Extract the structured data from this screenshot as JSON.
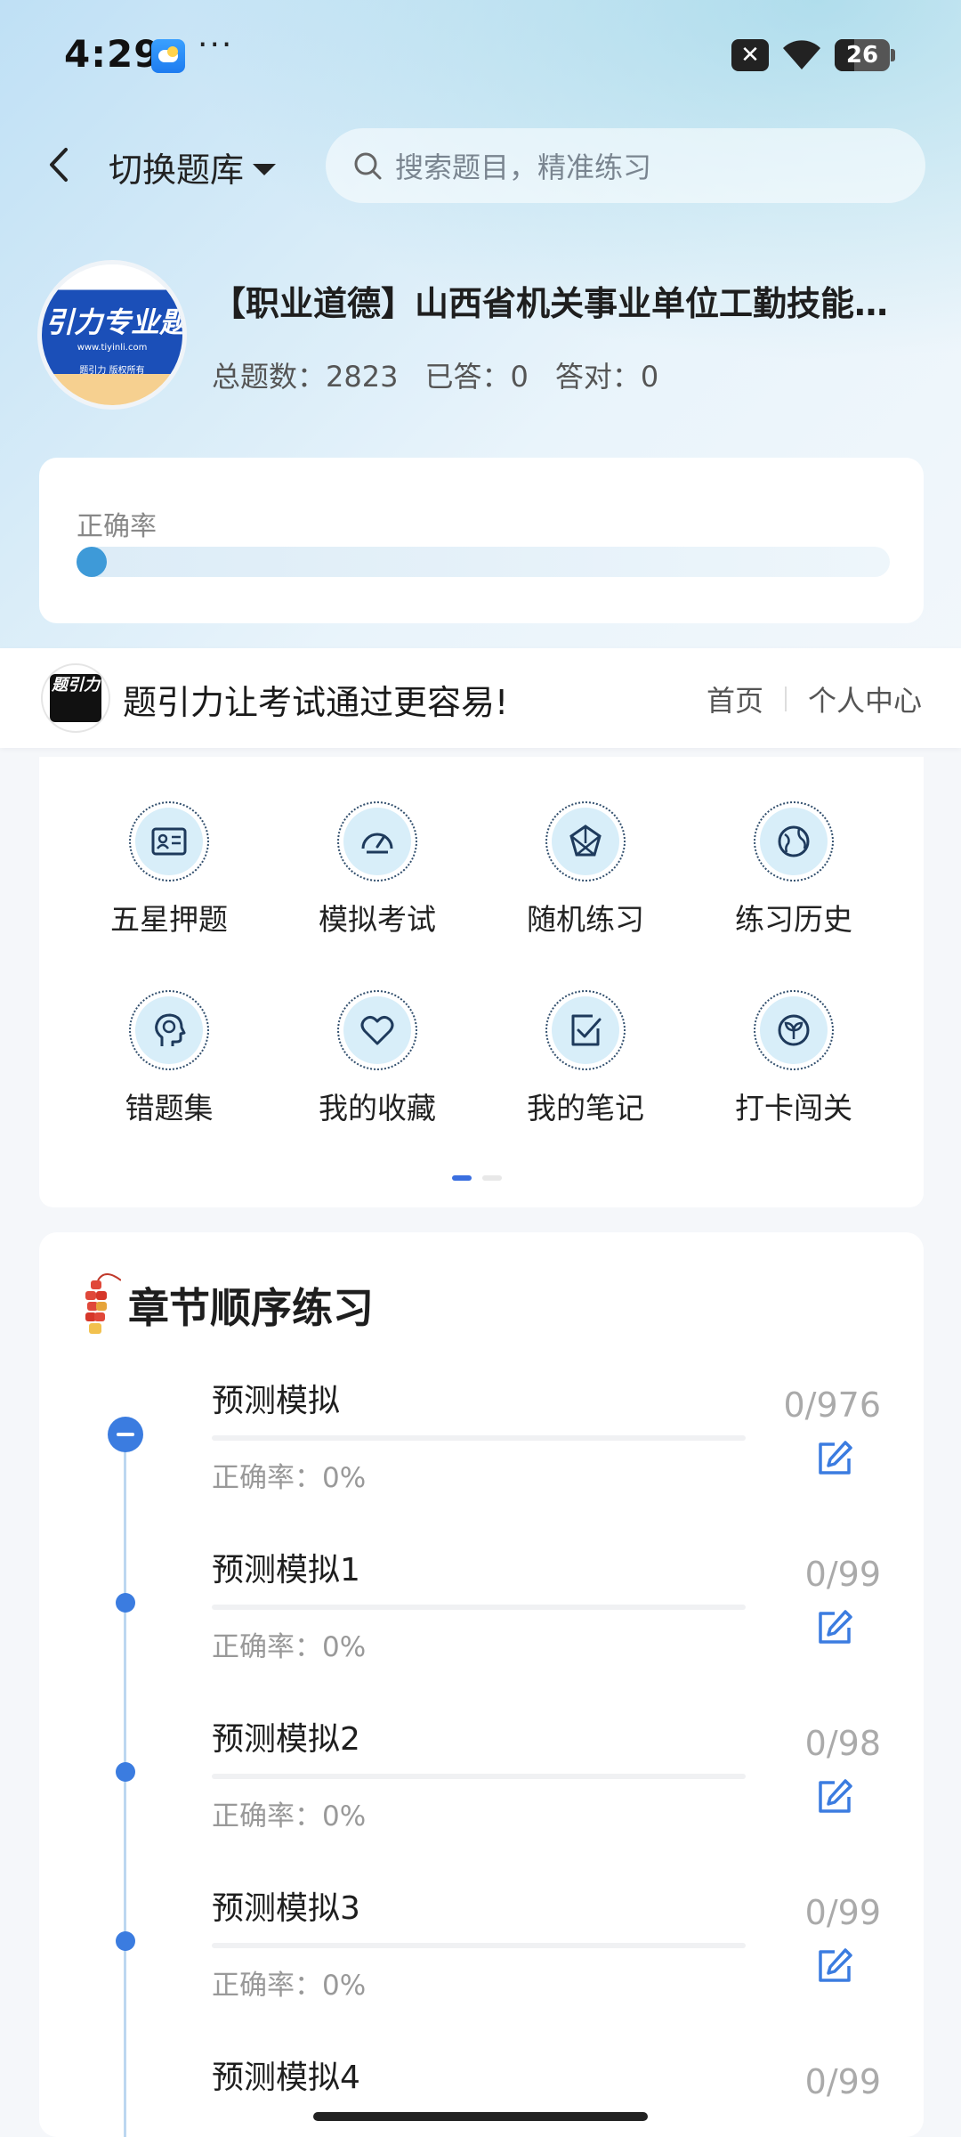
{
  "status_bar": {
    "time": "4:29",
    "dots": "···",
    "battery": "26"
  },
  "header": {
    "switch_label": "切换题库",
    "search_placeholder": "搜索题目，精准练习"
  },
  "bank": {
    "logo_text": "引力专业题",
    "logo_url": "www.tiyinli.com",
    "logo_sub": "题引力 版权所有",
    "title": "【职业道德】山西省机关事业单位工勤技能岗位",
    "stats": {
      "total_label": "总题数：",
      "total_value": "2823",
      "answered_label": "已答：",
      "answered_value": "0",
      "correct_label": "答对：",
      "correct_value": "0"
    }
  },
  "accuracy": {
    "label": "正确率",
    "value": 0
  },
  "banner": {
    "logo_text": "题引力",
    "slogan": "题引力让考试通过更容易!",
    "nav": [
      "首页",
      "个人中心"
    ]
  },
  "menu": {
    "items": [
      {
        "label": "五星押题",
        "icon": "id-card-icon"
      },
      {
        "label": "模拟考试",
        "icon": "speedometer-icon"
      },
      {
        "label": "随机练习",
        "icon": "network-icon"
      },
      {
        "label": "练习历史",
        "icon": "globe-icon"
      },
      {
        "label": "错题集",
        "icon": "head-icon"
      },
      {
        "label": "我的收藏",
        "icon": "heart-icon"
      },
      {
        "label": "我的笔记",
        "icon": "note-check-icon"
      },
      {
        "label": "打卡闯关",
        "icon": "sprout-icon"
      }
    ],
    "page_index": 0,
    "page_count": 2
  },
  "chapter": {
    "title": "章节顺序练习",
    "items": [
      {
        "name": "预测模拟",
        "accuracy": "正确率：0%",
        "progress": "0/976"
      },
      {
        "name": "预测模拟1",
        "accuracy": "正确率：0%",
        "progress": "0/99"
      },
      {
        "name": "预测模拟2",
        "accuracy": "正确率：0%",
        "progress": "0/98"
      },
      {
        "name": "预测模拟3",
        "accuracy": "正确率：0%",
        "progress": "0/99"
      },
      {
        "name": "预测模拟4",
        "accuracy": "",
        "progress": "0/99"
      }
    ]
  },
  "colors": {
    "accent": "#3b7ce0",
    "accuracy_fill": "#3e9ad8"
  }
}
